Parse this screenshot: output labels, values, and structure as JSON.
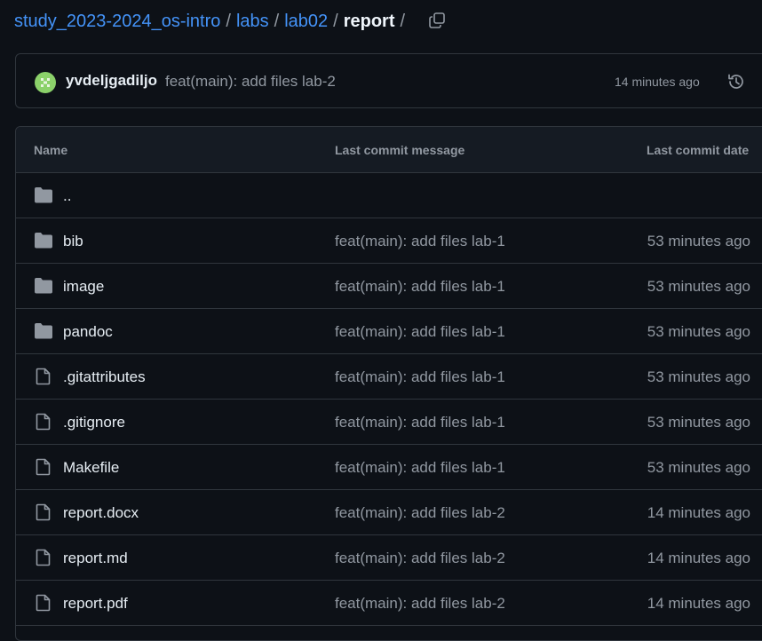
{
  "breadcrumb": {
    "repo": "study_2023-2024_os-intro",
    "sep": "/",
    "items": [
      "labs",
      "lab02"
    ],
    "current": "report"
  },
  "latest_commit": {
    "author": "yvdeljgadiljo",
    "message": "feat(main): add files lab-2",
    "time": "14 minutes ago"
  },
  "table": {
    "headers": {
      "name": "Name",
      "message": "Last commit message",
      "date": "Last commit date"
    },
    "parent_dir": "..",
    "rows": [
      {
        "name": "bib",
        "type": "folder",
        "message": "feat(main): add files lab-1",
        "date": "53 minutes ago"
      },
      {
        "name": "image",
        "type": "folder",
        "message": "feat(main): add files lab-1",
        "date": "53 minutes ago"
      },
      {
        "name": "pandoc",
        "type": "folder",
        "message": "feat(main): add files lab-1",
        "date": "53 minutes ago"
      },
      {
        "name": ".gitattributes",
        "type": "file",
        "message": "feat(main): add files lab-1",
        "date": "53 minutes ago"
      },
      {
        "name": ".gitignore",
        "type": "file",
        "message": "feat(main): add files lab-1",
        "date": "53 minutes ago"
      },
      {
        "name": "Makefile",
        "type": "file",
        "message": "feat(main): add files lab-1",
        "date": "53 minutes ago"
      },
      {
        "name": "report.docx",
        "type": "file",
        "message": "feat(main): add files lab-2",
        "date": "14 minutes ago"
      },
      {
        "name": "report.md",
        "type": "file",
        "message": "feat(main): add files lab-2",
        "date": "14 minutes ago"
      },
      {
        "name": "report.pdf",
        "type": "file",
        "message": "feat(main): add files lab-2",
        "date": "14 minutes ago"
      }
    ]
  },
  "icons": {
    "folder": "folder-icon",
    "file": "file-icon",
    "copy": "copy-icon",
    "history": "history-icon",
    "avatar": "identicon-avatar"
  },
  "colors": {
    "background": "#0d1117",
    "link": "#4493f8",
    "muted": "#9198a1",
    "border": "#30363d",
    "header_bg": "#151b23",
    "folder_icon": "#9198a1",
    "avatar_green": "#8bd16a"
  }
}
